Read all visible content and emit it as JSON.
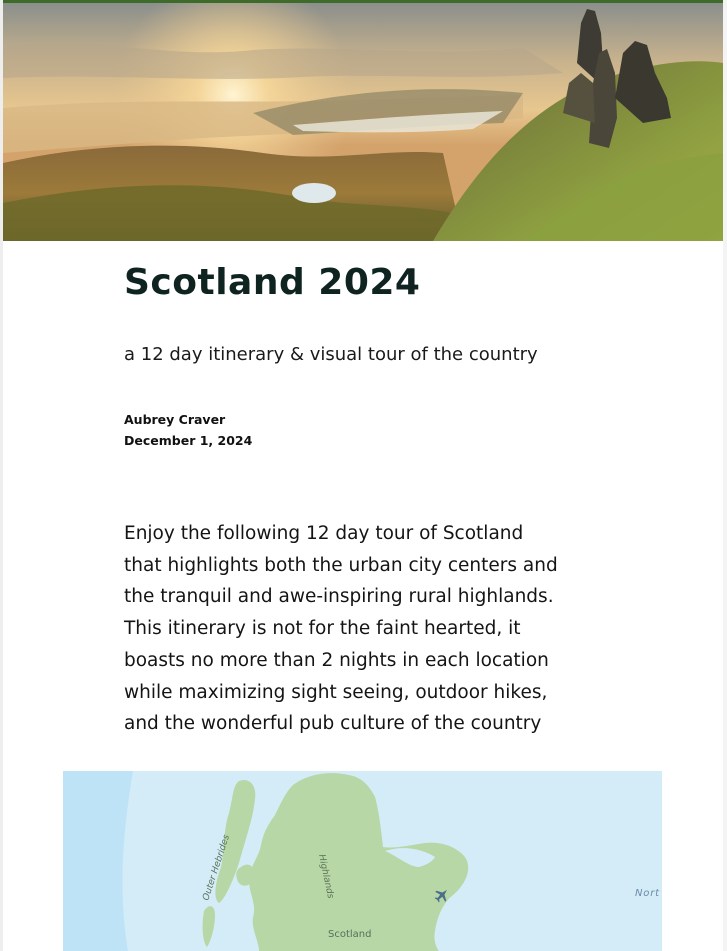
{
  "article": {
    "title": "Scotland 2024",
    "subtitle": "a 12 day itinerary & visual tour of the country",
    "author": "Aubrey Craver",
    "date": "December 1, 2024",
    "intro": "Enjoy the following 12 day tour of Scotland that highlights both the urban city centers and the tranquil and awe-inspiring rural highlands. This itinerary is not for the faint hearted, it boasts no more than 2 nights in each location while maximizing sight seeing, outdoor hikes, and the wonderful pub culture of the country"
  },
  "hero_image": {
    "alt": ""
  },
  "map": {
    "labels": {
      "outer_hebrides": "Outer Hebrides",
      "highlands": "Highlands",
      "scotland": "Scotland",
      "north_sea": "Nort"
    },
    "icon": "airport-icon"
  },
  "colors": {
    "accent": "#3f6b2a",
    "title": "#0f2320",
    "sea": "#d4ecf8",
    "land": "#b8d7a6"
  }
}
